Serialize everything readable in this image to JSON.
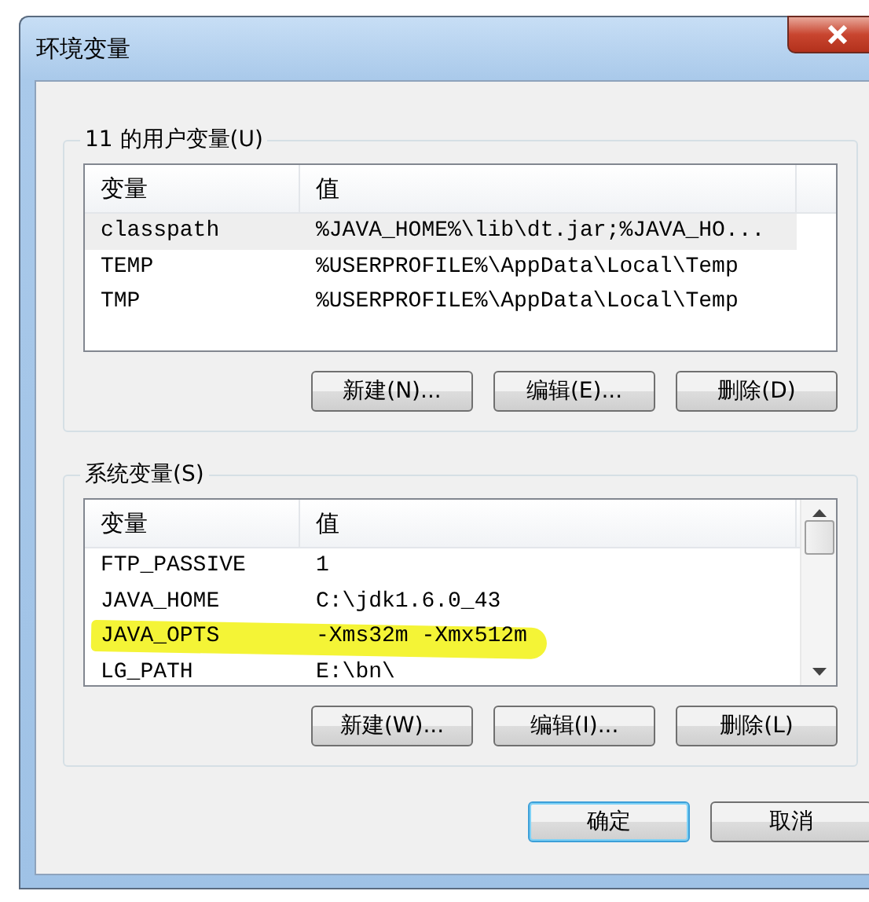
{
  "window": {
    "title": "环境变量"
  },
  "groups": [
    {
      "label": "11 的用户变量(U)",
      "columns": [
        "变量",
        "值"
      ],
      "scrollable": false,
      "rows": [
        {
          "name": "classpath",
          "value": "%JAVA_HOME%\\lib\\dt.jar;%JAVA_HO...",
          "selected": true,
          "highlighted": false
        },
        {
          "name": "TEMP",
          "value": "%USERPROFILE%\\AppData\\Local\\Temp",
          "selected": false,
          "highlighted": false
        },
        {
          "name": "TMP",
          "value": "%USERPROFILE%\\AppData\\Local\\Temp",
          "selected": false,
          "highlighted": false
        }
      ],
      "buttons": [
        "新建(N)...",
        "编辑(E)...",
        "删除(D)"
      ]
    },
    {
      "label": "系统变量(S)",
      "columns": [
        "变量",
        "值"
      ],
      "scrollable": true,
      "rows": [
        {
          "name": "FTP_PASSIVE",
          "value": "1",
          "selected": false,
          "highlighted": false
        },
        {
          "name": "JAVA_HOME",
          "value": "C:\\jdk1.6.0_43",
          "selected": false,
          "highlighted": false
        },
        {
          "name": "JAVA_OPTS",
          "value": "-Xms32m -Xmx512m",
          "selected": false,
          "highlighted": true
        },
        {
          "name": "LG_PATH",
          "value": "E:\\bn\\",
          "selected": false,
          "highlighted": false
        }
      ],
      "buttons": [
        "新建(W)...",
        "编辑(I)...",
        "删除(L)"
      ]
    }
  ],
  "buttons": [
    {
      "label": "确定",
      "default": true
    },
    {
      "label": "取消",
      "default": false
    }
  ]
}
